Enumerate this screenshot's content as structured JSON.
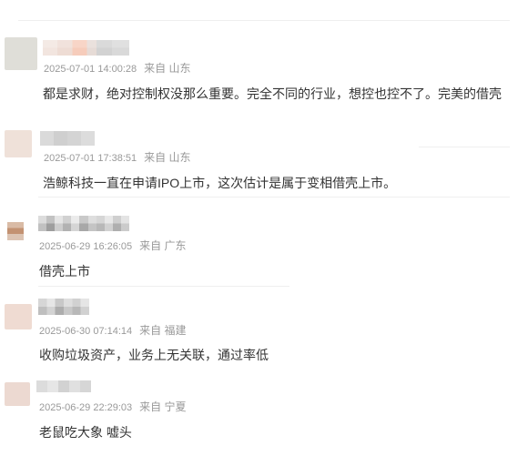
{
  "comments": [
    {
      "time": "2025-07-01 14:00:28",
      "location": "来自 山东",
      "text": "都是求财，绝对控制权没那么重要。完全不同的行业，想控也控不了。完美的借壳"
    },
    {
      "time": "2025-07-01 17:38:51",
      "location": "来自 山东",
      "text": "浩鲸科技一直在申请IPO上市，这次估计是属于变相借壳上市。"
    },
    {
      "time": "2025-06-29 16:26:05",
      "location": "来自 广东",
      "text": "借壳上市"
    },
    {
      "time": "2025-06-30 07:14:14",
      "location": "来自 福建",
      "text": "收购垃圾资产，业务上无关联，通过率低"
    },
    {
      "time": "2025-06-29 22:29:03",
      "location": "来自 宁夏",
      "text": "老鼠吃大象 嘘头"
    }
  ]
}
